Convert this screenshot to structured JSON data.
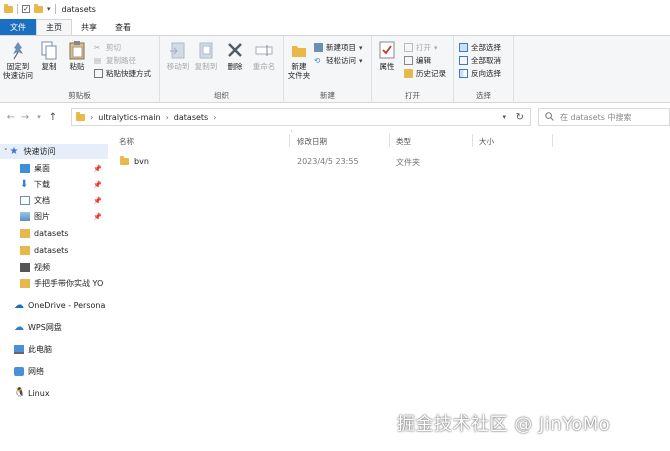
{
  "titlebar": {
    "title": "datasets"
  },
  "tabs": [
    {
      "label": "文件"
    },
    {
      "label": "主页"
    },
    {
      "label": "共享"
    },
    {
      "label": "查看"
    }
  ],
  "ribbon": {
    "clipboard": {
      "pin_quick": "固定到\n快速访问",
      "copy": "复制",
      "paste": "粘贴",
      "cut": "剪切",
      "copy_path": "复制路径",
      "paste_shortcut": "粘贴快捷方式",
      "label": "剪贴板"
    },
    "organize": {
      "move_to": "移动到",
      "copy_to": "复制到",
      "delete": "删除",
      "rename": "重命名",
      "label": "组织"
    },
    "new": {
      "new_folder": "新建\n文件夹",
      "new_item": "新建项目",
      "easy_access": "轻松访问",
      "label": "新建"
    },
    "open": {
      "properties": "属性",
      "open": "打开",
      "edit": "编辑",
      "history": "历史记录",
      "label": "打开"
    },
    "select": {
      "select_all": "全部选择",
      "select_none": "全部取消",
      "invert": "反向选择",
      "label": "选择"
    }
  },
  "address": {
    "crumbs": [
      "ultralytics-main",
      "datasets"
    ],
    "search_placeholder": "在 datasets 中搜索"
  },
  "navpane": {
    "quick_access": "快速访问",
    "items": [
      {
        "label": "桌面"
      },
      {
        "label": "下载"
      },
      {
        "label": "文档"
      },
      {
        "label": "图片"
      },
      {
        "label": "datasets"
      },
      {
        "label": "datasets"
      },
      {
        "label": "视频"
      },
      {
        "label": "手把手带你实战 YO"
      }
    ],
    "onedrive": "OneDrive - Persona",
    "wps": "WPS网盘",
    "this_pc": "此电脑",
    "network": "网络",
    "linux": "Linux"
  },
  "list": {
    "columns": {
      "name": "名称",
      "modified": "修改日期",
      "type": "类型",
      "size": "大小"
    },
    "rows": [
      {
        "name": "bvn",
        "modified": "2023/4/5 23:55",
        "type": "文件夹",
        "size": ""
      }
    ]
  },
  "watermark": "掘金技术社区 @ JinYoMo",
  "colors": {
    "file_tab": "#1a6fc1",
    "folder": "#e9b84a",
    "selection": "#e5eef9"
  }
}
